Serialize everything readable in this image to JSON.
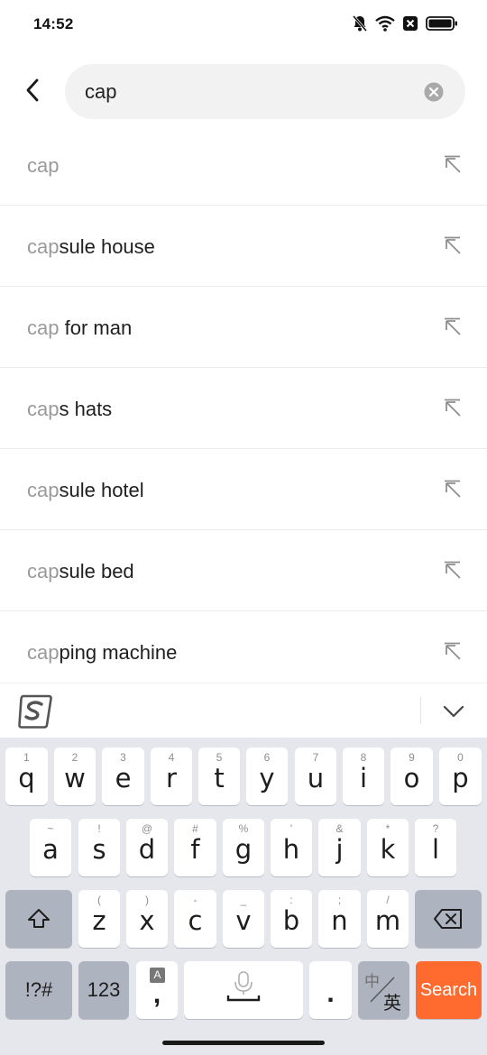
{
  "status_bar": {
    "time": "14:52",
    "icons": [
      "mute-bell-icon",
      "wifi-icon",
      "sim-off-icon",
      "battery-icon"
    ]
  },
  "search": {
    "value": "cap",
    "back_icon": "chevron-left-icon",
    "clear_icon": "clear-circle-icon"
  },
  "suggestions": [
    {
      "prefix": "cap",
      "rest": ""
    },
    {
      "prefix": "cap",
      "rest": "sule house"
    },
    {
      "prefix": "cap",
      "rest": " for man"
    },
    {
      "prefix": "cap",
      "rest": "s hats"
    },
    {
      "prefix": "cap",
      "rest": "sule hotel"
    },
    {
      "prefix": "cap",
      "rest": "sule bed"
    },
    {
      "prefix": "cap",
      "rest": "ping machine"
    }
  ],
  "keyboard": {
    "toolbar": {
      "logo": "sogou-logo-icon",
      "collapse": "chevron-down-icon"
    },
    "row1": [
      {
        "k": "q",
        "h": "1"
      },
      {
        "k": "w",
        "h": "2"
      },
      {
        "k": "e",
        "h": "3"
      },
      {
        "k": "r",
        "h": "4"
      },
      {
        "k": "t",
        "h": "5"
      },
      {
        "k": "y",
        "h": "6"
      },
      {
        "k": "u",
        "h": "7"
      },
      {
        "k": "i",
        "h": "8"
      },
      {
        "k": "o",
        "h": "9"
      },
      {
        "k": "p",
        "h": "0"
      }
    ],
    "row2": [
      {
        "k": "a",
        "h": "~"
      },
      {
        "k": "s",
        "h": "!"
      },
      {
        "k": "d",
        "h": "@"
      },
      {
        "k": "f",
        "h": "#"
      },
      {
        "k": "g",
        "h": "%"
      },
      {
        "k": "h",
        "h": "'"
      },
      {
        "k": "j",
        "h": "&"
      },
      {
        "k": "k",
        "h": "*"
      },
      {
        "k": "l",
        "h": "?"
      }
    ],
    "row3": [
      {
        "k": "z",
        "h": "("
      },
      {
        "k": "x",
        "h": ")"
      },
      {
        "k": "c",
        "h": "-"
      },
      {
        "k": "v",
        "h": "_"
      },
      {
        "k": "b",
        "h": ":"
      },
      {
        "k": "n",
        "h": ";"
      },
      {
        "k": "m",
        "h": "/"
      }
    ],
    "shift_icon": "shift-arrow-icon",
    "backspace_icon": "backspace-icon",
    "symbols_label": "!?#",
    "numbers_label": "123",
    "comma_hint": "A",
    "comma_label": ",",
    "space_icon": "microphone-icon",
    "period_label": ".",
    "lang_cn": "中",
    "lang_en": "英",
    "search_label": "Search"
  }
}
